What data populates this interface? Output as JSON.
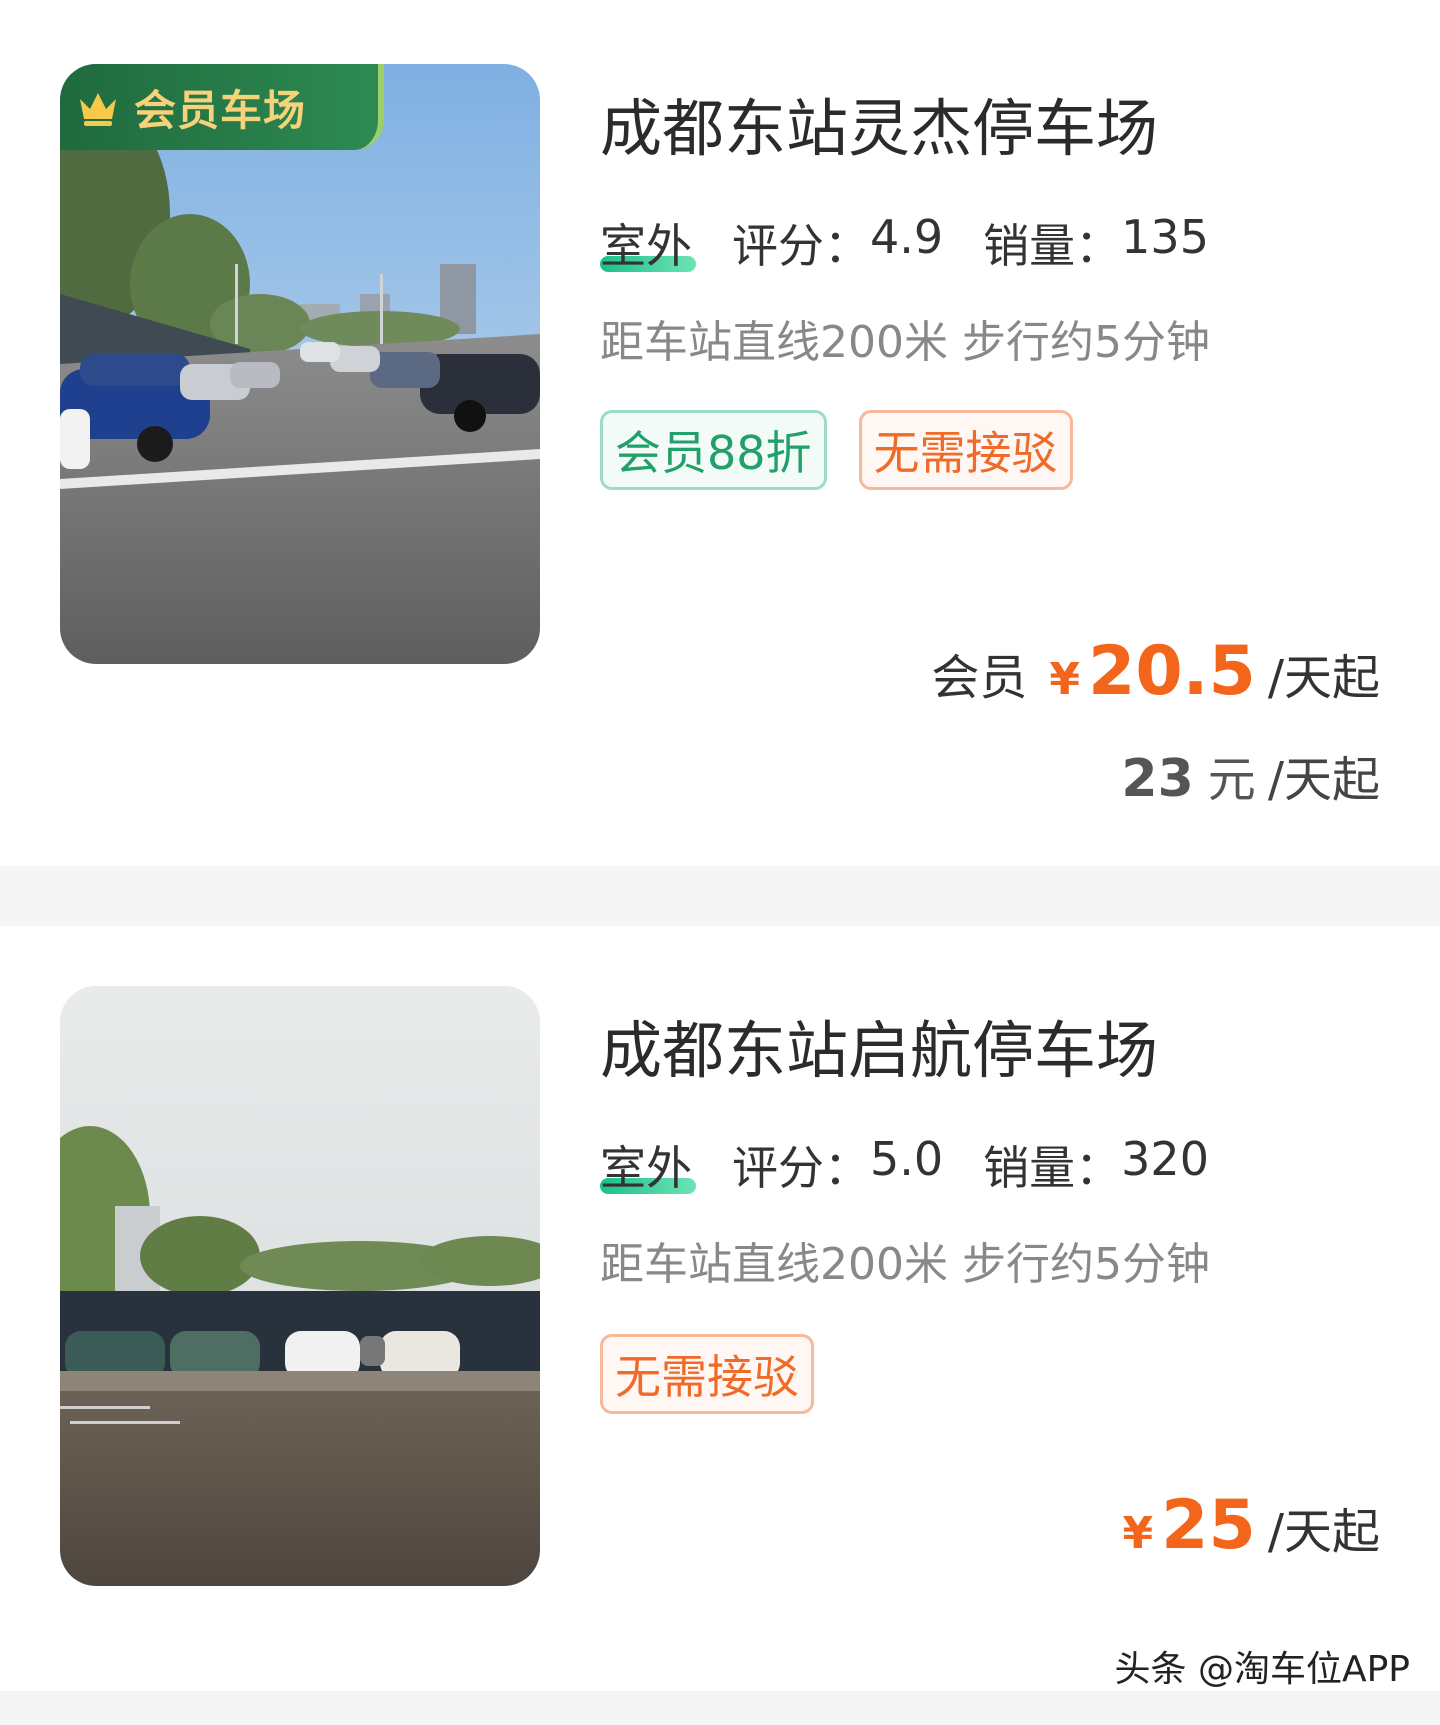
{
  "listings": [
    {
      "vip_badge": "会员车场",
      "title": "成都东站灵杰停车场",
      "type": "室外",
      "rating_label": "评分：",
      "rating": "4.9",
      "sales_label": "销量：",
      "sales": "135",
      "distance": "距车站直线200米 步行约5分钟",
      "tags": [
        "会员88折",
        "无需接驳"
      ],
      "member_price": {
        "label": "会员",
        "currency": "¥",
        "amount": "20.5",
        "unit": "/天起"
      },
      "regular_price": {
        "amount": "23",
        "currency": "元",
        "unit": "/天起"
      }
    },
    {
      "title": "成都东站启航停车场",
      "type": "室外",
      "rating_label": "评分：",
      "rating": "5.0",
      "sales_label": "销量：",
      "sales": "320",
      "distance": "距车站直线200米 步行约5分钟",
      "tags": [
        "无需接驳"
      ],
      "price": {
        "currency": "¥",
        "amount": "25",
        "unit": "/天起"
      }
    }
  ],
  "credit": "头条 @淘车位APP",
  "colors": {
    "accent_orange": "#f2651a",
    "tag_green": "#21a06a",
    "vip_green": "#1f6a3e",
    "vip_gold": "#f6d27a"
  }
}
